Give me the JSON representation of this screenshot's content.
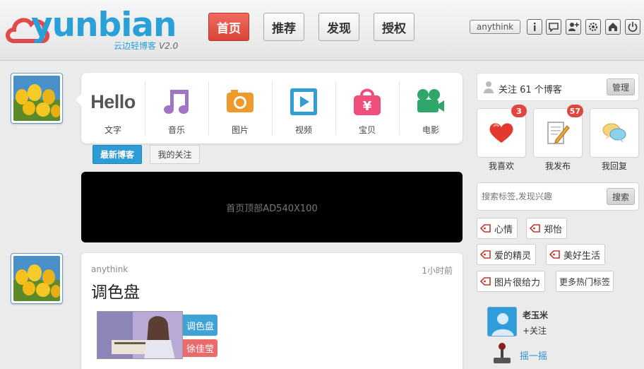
{
  "brand": {
    "logo_text": "yunbian",
    "tagline": "云边轻博客",
    "version": "V2.0"
  },
  "nav": {
    "items": [
      {
        "label": "首页",
        "active": true
      },
      {
        "label": "推荐",
        "active": false
      },
      {
        "label": "发现",
        "active": false
      },
      {
        "label": "授权",
        "active": false
      }
    ]
  },
  "user_menu": {
    "username": "anythink",
    "icons": [
      "info-icon",
      "message-icon",
      "add-user-icon",
      "settings-icon",
      "home-icon",
      "power-icon"
    ]
  },
  "post_types": [
    {
      "label": "文字",
      "icon": "hello-text-icon",
      "icon_text": "Hello"
    },
    {
      "label": "音乐",
      "icon": "music-note-icon",
      "color": "#a274c4"
    },
    {
      "label": "图片",
      "icon": "camera-icon",
      "color": "#ef9b2b"
    },
    {
      "label": "视频",
      "icon": "play-icon",
      "color": "#2e9ed4"
    },
    {
      "label": "宝贝",
      "icon": "shopping-bag-icon",
      "color": "#ef4f7c"
    },
    {
      "label": "电影",
      "icon": "movie-camera-icon",
      "color": "#2ea86a"
    }
  ],
  "feed_tabs": [
    {
      "label": "最新博客",
      "active": true
    },
    {
      "label": "我的关注",
      "active": false
    }
  ],
  "ad": {
    "text": "首页顶部AD540X100"
  },
  "post": {
    "author": "anythink",
    "time": "1小时前",
    "title": "调色盘",
    "tags": [
      "调色盘",
      "徐佳莹"
    ]
  },
  "sidebar": {
    "follow_text": "关注 61 个博客",
    "manage_label": "管理",
    "quick_actions": [
      {
        "label": "我喜欢",
        "icon": "heart-icon",
        "badge": "3"
      },
      {
        "label": "我发布",
        "icon": "edit-note-icon",
        "badge": "57"
      },
      {
        "label": "我回复",
        "icon": "speech-bubbles-icon",
        "badge": ""
      }
    ],
    "search": {
      "placeholder": "搜索标签,发现兴趣",
      "button": "搜索"
    },
    "hot_tags": [
      "心情",
      "郑怡",
      "爱的精灵",
      "美好生活",
      "图片很给力"
    ],
    "more_tags": "更多热门标签",
    "suggest": {
      "name": "老玉米",
      "action": "+关注"
    },
    "shake": "摇一摇"
  },
  "colors": {
    "accent_blue": "#2aa0d8",
    "nav_active_red": "#d9453a",
    "badge_red": "#e0453e",
    "tag_blue": "#3fa3d6",
    "tag_red": "#e96b6b"
  }
}
